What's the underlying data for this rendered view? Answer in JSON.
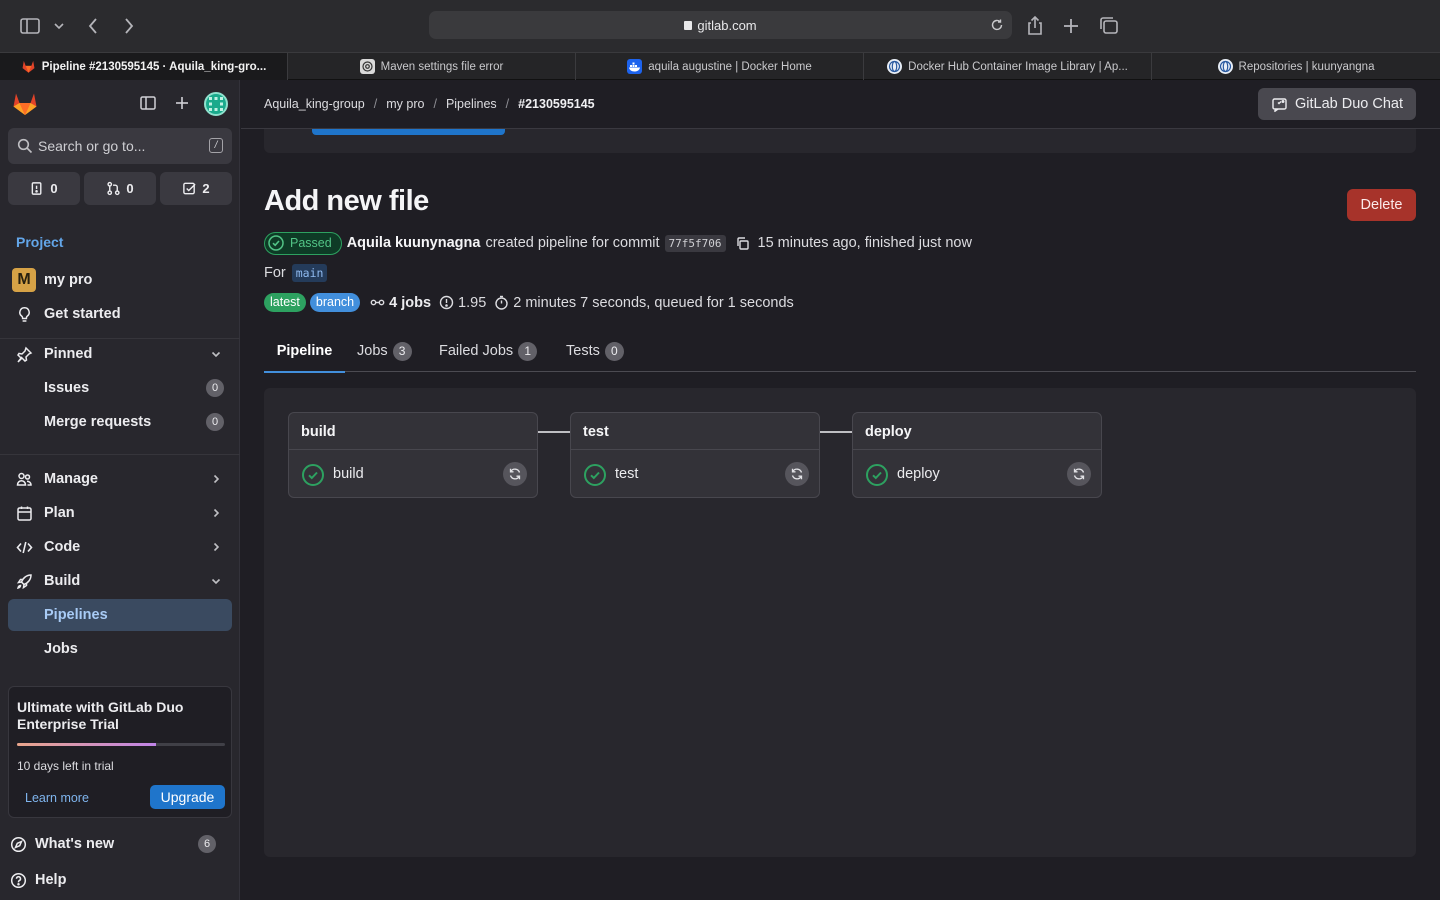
{
  "browser": {
    "url": "gitlab.com",
    "tabs": [
      {
        "title": "Pipeline #2130595145 · Aquila_king-gro...",
        "favicon": "gitlab-icon",
        "active": true
      },
      {
        "title": "Maven settings file error",
        "favicon": "openai-icon",
        "active": false
      },
      {
        "title": "aquila augustine | Docker Home",
        "favicon": "docker-icon",
        "active": false
      },
      {
        "title": "Docker Hub Container Image Library | Ap...",
        "favicon": "globe-icon",
        "active": false
      },
      {
        "title": "Repositories | kuunyangna",
        "favicon": "globe-icon",
        "active": false
      }
    ]
  },
  "sidebar": {
    "search_placeholder": "Search or go to...",
    "search_shortcut": "/",
    "counters": {
      "issues": "0",
      "merge_requests": "0",
      "todos": "2"
    },
    "section_title": "Project",
    "project_initial": "M",
    "project_name": "my pro",
    "get_started": "Get started",
    "pinned": "Pinned",
    "pinned_items": [
      {
        "label": "Issues",
        "count": "0"
      },
      {
        "label": "Merge requests",
        "count": "0"
      }
    ],
    "nav": {
      "manage": "Manage",
      "plan": "Plan",
      "code": "Code",
      "build": "Build",
      "pipelines": "Pipelines",
      "jobs": "Jobs"
    },
    "trial": {
      "title": "Ultimate with GitLab Duo Enterprise Trial",
      "days_left": "10 days left in trial",
      "progress": 0.67,
      "learn_more": "Learn more",
      "upgrade": "Upgrade"
    },
    "whats_new": "What's new",
    "whats_new_count": "6",
    "help": "Help"
  },
  "header": {
    "breadcrumbs": [
      "Aquila_king-group",
      "my pro",
      "Pipelines",
      "#2130595145"
    ],
    "duo_chat": "GitLab Duo Chat"
  },
  "pipeline": {
    "title": "Add new file",
    "delete_label": "Delete",
    "status": "Passed",
    "author": "Aquila kuunynagna",
    "created_text": "created pipeline for commit",
    "commit_sha": "77f5f706",
    "timing_text": "15 minutes ago, finished just now",
    "for_label": "For",
    "ref": "main",
    "badges": [
      "latest",
      "branch"
    ],
    "jobs_count": "4 jobs",
    "coverage": "1.95",
    "duration": "2 minutes 7 seconds, queued for 1 seconds",
    "tabs": [
      {
        "label": "Pipeline",
        "count": null
      },
      {
        "label": "Jobs",
        "count": "3"
      },
      {
        "label": "Failed Jobs",
        "count": "1"
      },
      {
        "label": "Tests",
        "count": "0"
      }
    ],
    "stages": [
      {
        "name": "build",
        "job": "build",
        "status": "success"
      },
      {
        "name": "test",
        "job": "test",
        "status": "success"
      },
      {
        "name": "deploy",
        "job": "deploy",
        "status": "success"
      }
    ]
  },
  "colors": {
    "accent": "#428fdc",
    "success": "#2da160",
    "danger": "#a7332a"
  }
}
